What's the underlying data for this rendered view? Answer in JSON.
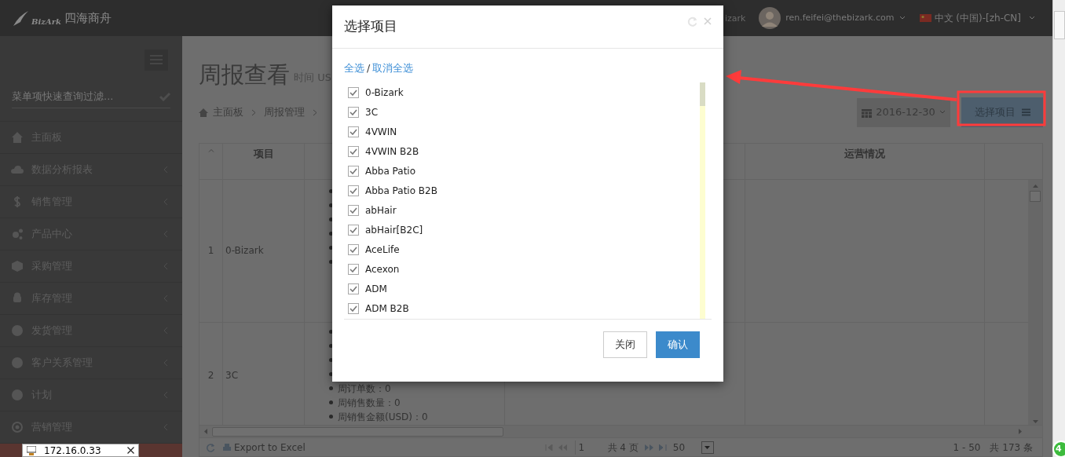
{
  "header": {
    "logo_text": "BizArk",
    "brand": "四海商舟",
    "partial_text": "izark",
    "user_email": "ren.feifei@thebizark.com",
    "language": "中文 (中国)-[zh-CN]"
  },
  "sidebar": {
    "filter_placeholder": "菜单项快速查询过滤...",
    "items": [
      {
        "label": "主面板",
        "expandable": false,
        "selected": false
      },
      {
        "label": "数据分析报表",
        "expandable": true,
        "selected": false
      },
      {
        "label": "销售管理",
        "expandable": true,
        "selected": false
      },
      {
        "label": "产品中心",
        "expandable": true,
        "selected": false
      },
      {
        "label": "采购管理",
        "expandable": true,
        "selected": false
      },
      {
        "label": "库存管理",
        "expandable": true,
        "selected": false
      },
      {
        "label": "发货管理",
        "expandable": true,
        "selected": false
      },
      {
        "label": "客户关系管理",
        "expandable": true,
        "selected": false
      },
      {
        "label": "计划",
        "expandable": true,
        "selected": false
      },
      {
        "label": "营销管理",
        "expandable": true,
        "selected": false
      },
      {
        "selected": true
      }
    ]
  },
  "page": {
    "title": "周报查看",
    "subtitle": "时间 US",
    "breadcrumb": [
      "主面板",
      "周报管理"
    ],
    "date": "2016-12-30",
    "select_button": "选择项目"
  },
  "table": {
    "columns": [
      "项目",
      "运营情况"
    ],
    "rows": [
      {
        "index": "1",
        "project": "0-Bizark",
        "metrics": [
          {
            "kind": "covered"
          },
          {
            "kind": "covered"
          },
          {
            "kind": "covered"
          },
          {
            "kind": "covered"
          },
          {
            "kind": "covered"
          },
          {
            "kind": "covered"
          }
        ]
      },
      {
        "index": "2",
        "project": "3C",
        "metrics": [
          {
            "kind": "covered"
          },
          {
            "kind": "covered"
          },
          {
            "kind": "covered"
          },
          {
            "kind": "covered"
          },
          {
            "kind": "text",
            "text": "周订单数：0"
          },
          {
            "kind": "text",
            "text": "周销售数量：0"
          },
          {
            "kind": "text",
            "text": "周销售金额(USD)：0"
          }
        ]
      }
    ]
  },
  "footer": {
    "export": "Export to Excel",
    "page": "1",
    "pages": "共 4 页",
    "page_size": "50",
    "range": "1 - 50",
    "total": "共 173 条"
  },
  "modal": {
    "title": "选择项目",
    "select_all": "全选",
    "separator": "/",
    "deselect_all": "取消全选",
    "items": [
      {
        "label": "0-Bizark",
        "checked": true
      },
      {
        "label": "3C",
        "checked": true
      },
      {
        "label": "4VWIN",
        "checked": true
      },
      {
        "label": "4VWIN B2B",
        "checked": true
      },
      {
        "label": "Abba Patio",
        "checked": true
      },
      {
        "label": "Abba Patio B2B",
        "checked": true
      },
      {
        "label": "abHair",
        "checked": true
      },
      {
        "label": "abHair[B2C]",
        "checked": true
      },
      {
        "label": "AceLife",
        "checked": true
      },
      {
        "label": "Acexon",
        "checked": true
      },
      {
        "label": "ADM",
        "checked": true
      },
      {
        "label": "ADM B2B",
        "checked": true
      }
    ],
    "buttons": [
      {
        "label": "关闭",
        "kind": "default"
      },
      {
        "label": "确认",
        "kind": "primary"
      }
    ]
  },
  "ip_popup": {
    "address": "172.16.0.33"
  },
  "badge": {
    "text": "4"
  }
}
